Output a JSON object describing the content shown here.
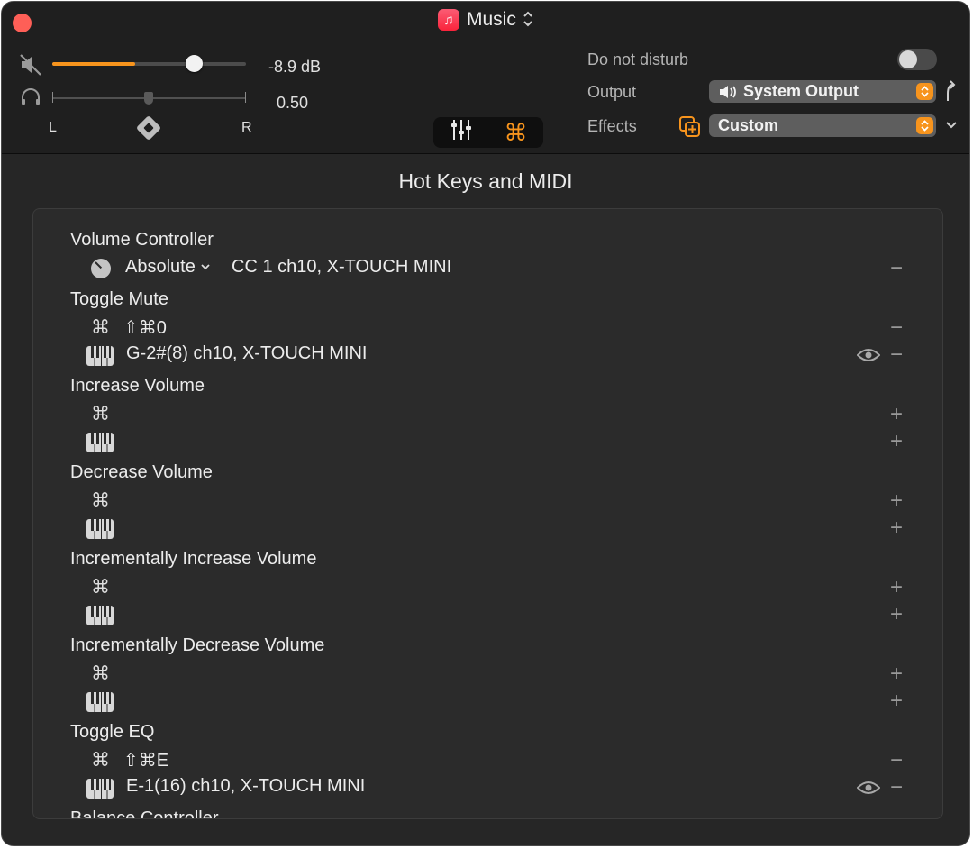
{
  "window": {
    "app_title": "Music",
    "app_icon": "music-note-icon",
    "title_chevron": "⌃⌄"
  },
  "mixer": {
    "volume_value": "-8.9 dB",
    "volume_level": 0.46,
    "balance_value": "0.50",
    "balance_level": 0.5,
    "left_label": "L",
    "right_label": "R"
  },
  "settings": {
    "dnd_label": "Do not disturb",
    "dnd_on": false,
    "output_label": "Output",
    "output_value": "System Output",
    "effects_label": "Effects",
    "effects_value": "Custom"
  },
  "colors": {
    "accent": "#f7941d",
    "background": "#262626",
    "panel": "#2b2b2b"
  },
  "section_title": "Hot Keys and MIDI",
  "actions": [
    {
      "title": "Volume Controller",
      "bindings": [
        {
          "type": "midi-knob",
          "icon": "knob-icon",
          "mode": "Absolute",
          "text": "CC 1 ch10, X-TOUCH MINI",
          "button": "−"
        }
      ]
    },
    {
      "title": "Toggle Mute",
      "bindings": [
        {
          "type": "hotkey",
          "icon": "command-icon",
          "text": "⇧⌘0",
          "button": "−"
        },
        {
          "type": "midi",
          "icon": "piano-icon",
          "text": "G-2#(8) ch10, X-TOUCH MINI",
          "eye": true,
          "button": "−"
        }
      ]
    },
    {
      "title": "Increase Volume",
      "bindings": [
        {
          "type": "hotkey",
          "icon": "command-icon",
          "text": "",
          "button": "+"
        },
        {
          "type": "midi",
          "icon": "piano-icon",
          "text": "",
          "button": "+"
        }
      ]
    },
    {
      "title": "Decrease Volume",
      "bindings": [
        {
          "type": "hotkey",
          "icon": "command-icon",
          "text": "",
          "button": "+"
        },
        {
          "type": "midi",
          "icon": "piano-icon",
          "text": "",
          "button": "+"
        }
      ]
    },
    {
      "title": "Incrementally Increase Volume",
      "bindings": [
        {
          "type": "hotkey",
          "icon": "command-icon",
          "text": "",
          "button": "+"
        },
        {
          "type": "midi",
          "icon": "piano-icon",
          "text": "",
          "button": "+"
        }
      ]
    },
    {
      "title": "Incrementally Decrease Volume",
      "bindings": [
        {
          "type": "hotkey",
          "icon": "command-icon",
          "text": "",
          "button": "+"
        },
        {
          "type": "midi",
          "icon": "piano-icon",
          "text": "",
          "button": "+"
        }
      ]
    },
    {
      "title": "Toggle EQ",
      "bindings": [
        {
          "type": "hotkey",
          "icon": "command-icon",
          "text": "⇧⌘E",
          "button": "−"
        },
        {
          "type": "midi",
          "icon": "piano-icon",
          "text": "E-1(16) ch10, X-TOUCH MINI",
          "eye": true,
          "button": "−"
        }
      ]
    },
    {
      "title": "Balance Controller",
      "bindings": []
    }
  ]
}
